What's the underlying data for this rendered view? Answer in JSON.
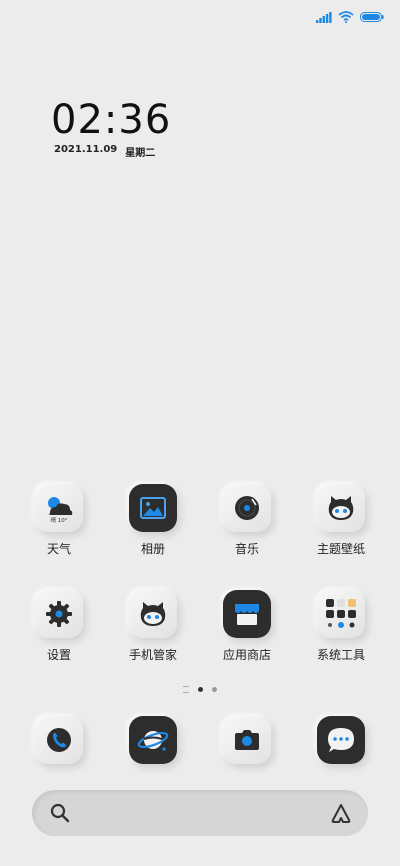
{
  "status_bar": {
    "signal_icon": "signal-icon",
    "wifi_icon": "wifi-icon",
    "battery_icon": "battery-icon"
  },
  "clock": {
    "time": "02:36",
    "date": "2021.11.09",
    "weekday": "星期二"
  },
  "apps_row1": [
    {
      "label": "天气",
      "icon": "weather-icon",
      "temp": "晴 10°"
    },
    {
      "label": "相册",
      "icon": "gallery-icon"
    },
    {
      "label": "音乐",
      "icon": "music-icon"
    },
    {
      "label": "主题壁纸",
      "icon": "themes-icon"
    }
  ],
  "apps_row2": [
    {
      "label": "设置",
      "icon": "settings-icon"
    },
    {
      "label": "手机管家",
      "icon": "security-icon"
    },
    {
      "label": "应用商店",
      "icon": "store-icon"
    },
    {
      "label": "系统工具",
      "icon": "tools-folder-icon"
    }
  ],
  "page_indicator": {
    "pages": 3,
    "current": 2
  },
  "dock": [
    {
      "icon": "phone-icon"
    },
    {
      "icon": "browser-icon"
    },
    {
      "icon": "camera-icon"
    },
    {
      "icon": "messages-icon"
    }
  ],
  "search": {
    "search_icon": "search-icon",
    "assistant_icon": "assistant-icon"
  },
  "colors": {
    "accent": "#1e88e5",
    "background": "#ececec",
    "dark_tile": "#2d2d2d"
  }
}
